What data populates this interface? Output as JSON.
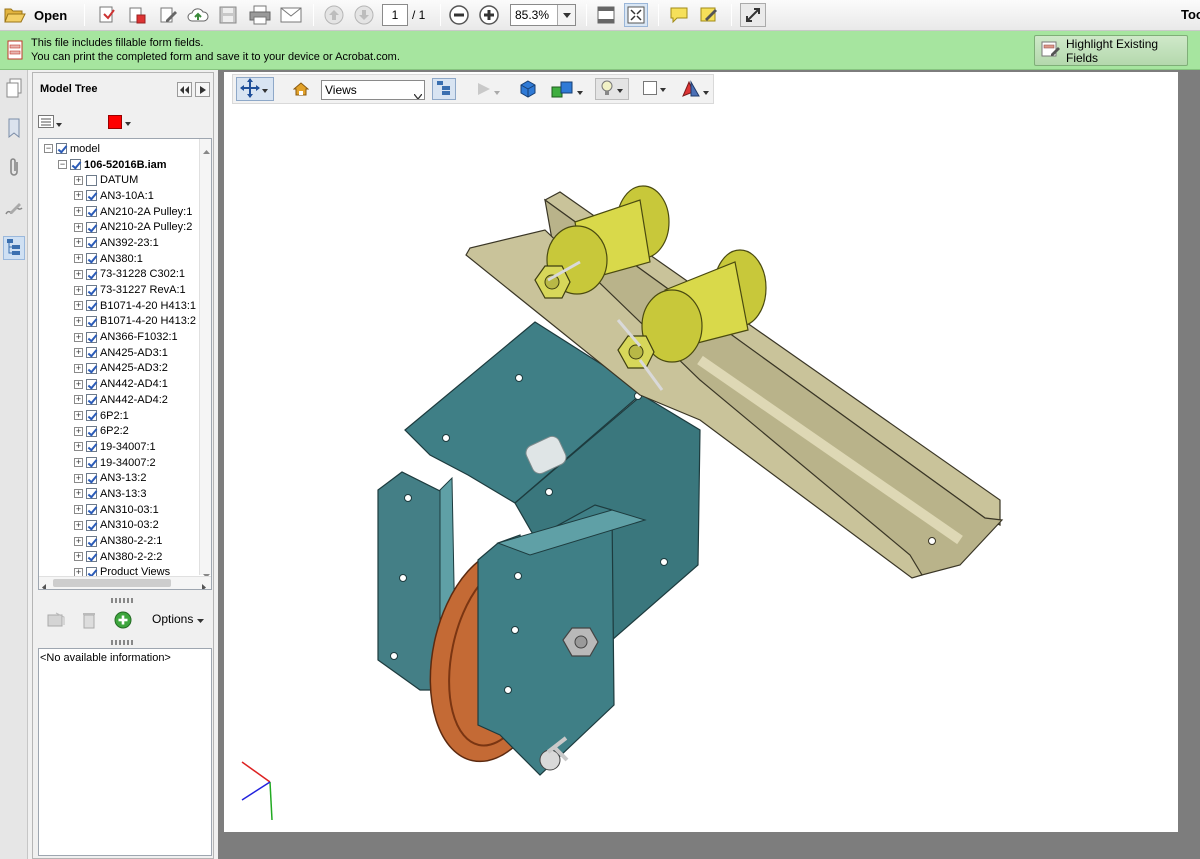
{
  "toolbar": {
    "open_label": "Open",
    "page_current": "1",
    "page_total": "/ 1",
    "zoom_value": "85.3%",
    "tools_label": "Too"
  },
  "notice": {
    "line1": "This file includes fillable form fields.",
    "line2": "You can print the completed form and save it to your device or Acrobat.com.",
    "highlight_label": "Highlight Existing Fields"
  },
  "model_tree": {
    "title": "Model Tree",
    "swatch_color": "#ff0000",
    "items": [
      {
        "label": "model",
        "checked": true,
        "expanded": true,
        "bold": false
      },
      {
        "label": "106-52016B.iam",
        "checked": true,
        "expanded": true,
        "bold": true
      },
      {
        "label": "DATUM",
        "checked": false,
        "expanded": false,
        "bold": false
      },
      {
        "label": "AN3-10A:1",
        "checked": true,
        "expanded": false,
        "bold": false
      },
      {
        "label": "AN210-2A Pulley:1",
        "checked": true,
        "expanded": false,
        "bold": false
      },
      {
        "label": "AN210-2A Pulley:2",
        "checked": true,
        "expanded": false,
        "bold": false
      },
      {
        "label": "AN392-23:1",
        "checked": true,
        "expanded": false,
        "bold": false
      },
      {
        "label": "AN380:1",
        "checked": true,
        "expanded": false,
        "bold": false
      },
      {
        "label": "73-31228 C302:1",
        "checked": true,
        "expanded": false,
        "bold": false
      },
      {
        "label": "73-31227 RevA:1",
        "checked": true,
        "expanded": false,
        "bold": false
      },
      {
        "label": "B1071-4-20 H413:1",
        "checked": true,
        "expanded": false,
        "bold": false
      },
      {
        "label": "B1071-4-20 H413:2",
        "checked": true,
        "expanded": false,
        "bold": false
      },
      {
        "label": "AN366-F1032:1",
        "checked": true,
        "expanded": false,
        "bold": false
      },
      {
        "label": "AN425-AD3:1",
        "checked": true,
        "expanded": false,
        "bold": false
      },
      {
        "label": "AN425-AD3:2",
        "checked": true,
        "expanded": false,
        "bold": false
      },
      {
        "label": "AN442-AD4:1",
        "checked": true,
        "expanded": false,
        "bold": false
      },
      {
        "label": "AN442-AD4:2",
        "checked": true,
        "expanded": false,
        "bold": false
      },
      {
        "label": "6P2:1",
        "checked": true,
        "expanded": false,
        "bold": false
      },
      {
        "label": "6P2:2",
        "checked": true,
        "expanded": false,
        "bold": false
      },
      {
        "label": "19-34007:1",
        "checked": true,
        "expanded": false,
        "bold": false
      },
      {
        "label": "19-34007:2",
        "checked": true,
        "expanded": false,
        "bold": false
      },
      {
        "label": "AN3-13:2",
        "checked": true,
        "expanded": false,
        "bold": false
      },
      {
        "label": "AN3-13:3",
        "checked": true,
        "expanded": false,
        "bold": false
      },
      {
        "label": "AN310-03:1",
        "checked": true,
        "expanded": false,
        "bold": false
      },
      {
        "label": "AN310-03:2",
        "checked": true,
        "expanded": false,
        "bold": false
      },
      {
        "label": "AN380-2-2:1",
        "checked": true,
        "expanded": false,
        "bold": false
      },
      {
        "label": "AN380-2-2:2",
        "checked": true,
        "expanded": false,
        "bold": false
      },
      {
        "label": "Product Views",
        "checked": true,
        "expanded": false,
        "bold": false
      }
    ],
    "options_label": "Options",
    "info_text": "<No available information>"
  },
  "viewer_3d": {
    "views_value": "Views"
  },
  "colors": {
    "notice_bg": "#a6e59f",
    "bracket": "#3f7f86",
    "arm": "#c9c39a",
    "pulley": "#c8c83a",
    "sheave": "#c46a35"
  }
}
